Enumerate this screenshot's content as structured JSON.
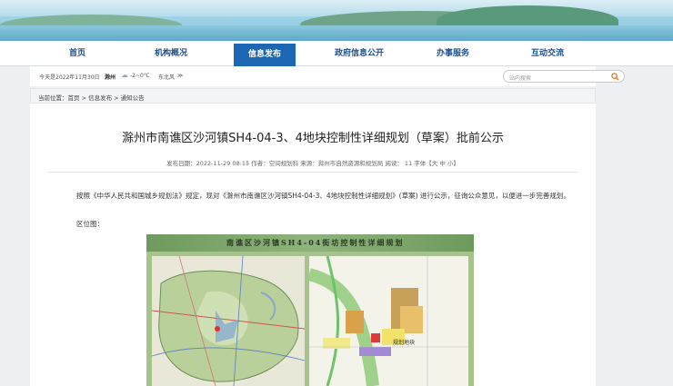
{
  "nav": {
    "items": [
      {
        "label": "首页"
      },
      {
        "label": "机构概况"
      },
      {
        "label": "信息发布"
      },
      {
        "label": "政府信息公开"
      },
      {
        "label": "办事服务"
      },
      {
        "label": "互动交流"
      }
    ]
  },
  "infobar": {
    "date": "今天是2022年11月30日",
    "city": "滁州",
    "temp": "-2~0℃",
    "wind": "东北风",
    "wind_arrow": "≫"
  },
  "search": {
    "placeholder": "站内搜索"
  },
  "breadcrumb": "当前位置：首页 > 信息发布 > 通知公告",
  "article": {
    "title": "滁州市南谯区沙河镇SH4-04-3、4地块控制性详细规划（草案）批前公示",
    "meta": "发布日期：2022-11-29 08:15    作者：空间规划科    来源：滁州市自然资源和规划局    阅读： 11    字体【大 中 小】",
    "paragraph": "按照《中华人民共和国城乡规划法》规定，现对《滁州市南谯区沙河镇SH4-04-3、4地块控制性详细规划》(草案) 进行公示，征询公众意见，以便进一步完善规划。",
    "location_label": "区位图：",
    "map_title": "南谯区沙河镇SH4-04街坊控制性详细规划",
    "map_right_label": "规划地块"
  },
  "colors": {
    "nav_active": "#1c67b3",
    "nav_text": "#1d4f8c"
  }
}
